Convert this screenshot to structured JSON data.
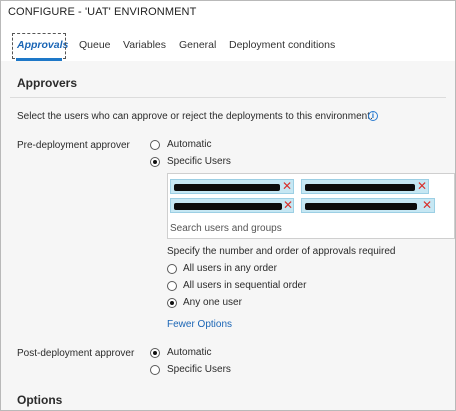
{
  "window": {
    "title": "CONFIGURE - 'UAT' ENVIRONMENT"
  },
  "tabs": [
    {
      "label": "Approvals",
      "active": true
    },
    {
      "label": "Queue",
      "active": false
    },
    {
      "label": "Variables",
      "active": false
    },
    {
      "label": "General",
      "active": false
    },
    {
      "label": "Deployment conditions",
      "active": false
    }
  ],
  "approvers": {
    "heading": "Approvers",
    "description": "Select the users who can approve or reject the deployments to this environment.",
    "info_icon": "info-icon",
    "pre": {
      "label": "Pre-deployment approver",
      "options": [
        "Automatic",
        "Specific Users"
      ],
      "selected": "Specific Users",
      "users_redacted": 4,
      "search_placeholder": "Search users and groups",
      "order_prompt": "Specify the number and order of approvals required",
      "order_options": [
        "All users in any order",
        "All users in sequential order",
        "Any one user"
      ],
      "order_selected": "Any one user",
      "fewer_options": "Fewer Options"
    },
    "post": {
      "label": "Post-deployment approver",
      "options": [
        "Automatic",
        "Specific Users"
      ],
      "selected": "Automatic"
    }
  },
  "options": {
    "heading": "Options"
  },
  "colors": {
    "accent": "#1a65b5",
    "chip": "#c6e7f3",
    "remove": "#d8312c"
  }
}
